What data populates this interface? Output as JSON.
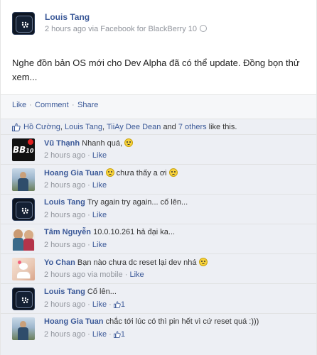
{
  "post": {
    "author": "Louis Tang",
    "meta": "2 hours ago via Facebook for BlackBerry 10",
    "content": "Nghe đồn bản OS mới cho Dev Alpha đã có thể update. Đồng bọn thử xem...",
    "actions": {
      "like": "Like",
      "comment": "Comment",
      "share": "Share",
      "separator": "·"
    }
  },
  "likes": {
    "names": [
      "Hồ Cường",
      "Louis Tang",
      "TiiAy Dee Dean"
    ],
    "and_text": "and",
    "others": "7 others",
    "suffix": "like this."
  },
  "comments": [
    {
      "name": "Vũ Thạnh",
      "text": "Nhanh quá,",
      "time": "2 hours ago",
      "like": "Like",
      "avatar": "bb10-logo"
    },
    {
      "name": "Hoang Gia Tuan",
      "text": "chưa thấy a ơi",
      "time": "2 hours ago",
      "like": "Like",
      "avatar": "person-photo"
    },
    {
      "name": "Louis Tang",
      "text": "Try again try again... cố lên...",
      "time": "2 hours ago",
      "like": "Like",
      "avatar": "blackberry-logo"
    },
    {
      "name": "Tâm Nguyễn",
      "text": "10.0.10.261 hả đại ka...",
      "time": "2 hours ago",
      "like": "Like",
      "avatar": "person-photo"
    },
    {
      "name": "Yo Chan",
      "text": "Bạn nào chưa dc reset lại dev nhá",
      "time": "2 hours ago via mobile",
      "like": "Like",
      "avatar": "person-photo"
    },
    {
      "name": "Louis Tang",
      "text": "Cố lên...",
      "time": "2 hours ago",
      "like": "Like",
      "like_count": "1",
      "avatar": "blackberry-logo"
    },
    {
      "name": "Hoang Gia Tuan",
      "text": "chắc tới lúc có thì pin hết vì cứ reset quá :)))",
      "time": "2 hours ago",
      "like": "Like",
      "like_count": "1",
      "avatar": "person-photo"
    }
  ],
  "colors": {
    "link": "#3b5998",
    "muted": "#90949c",
    "comment_bg": "#edeff4"
  }
}
